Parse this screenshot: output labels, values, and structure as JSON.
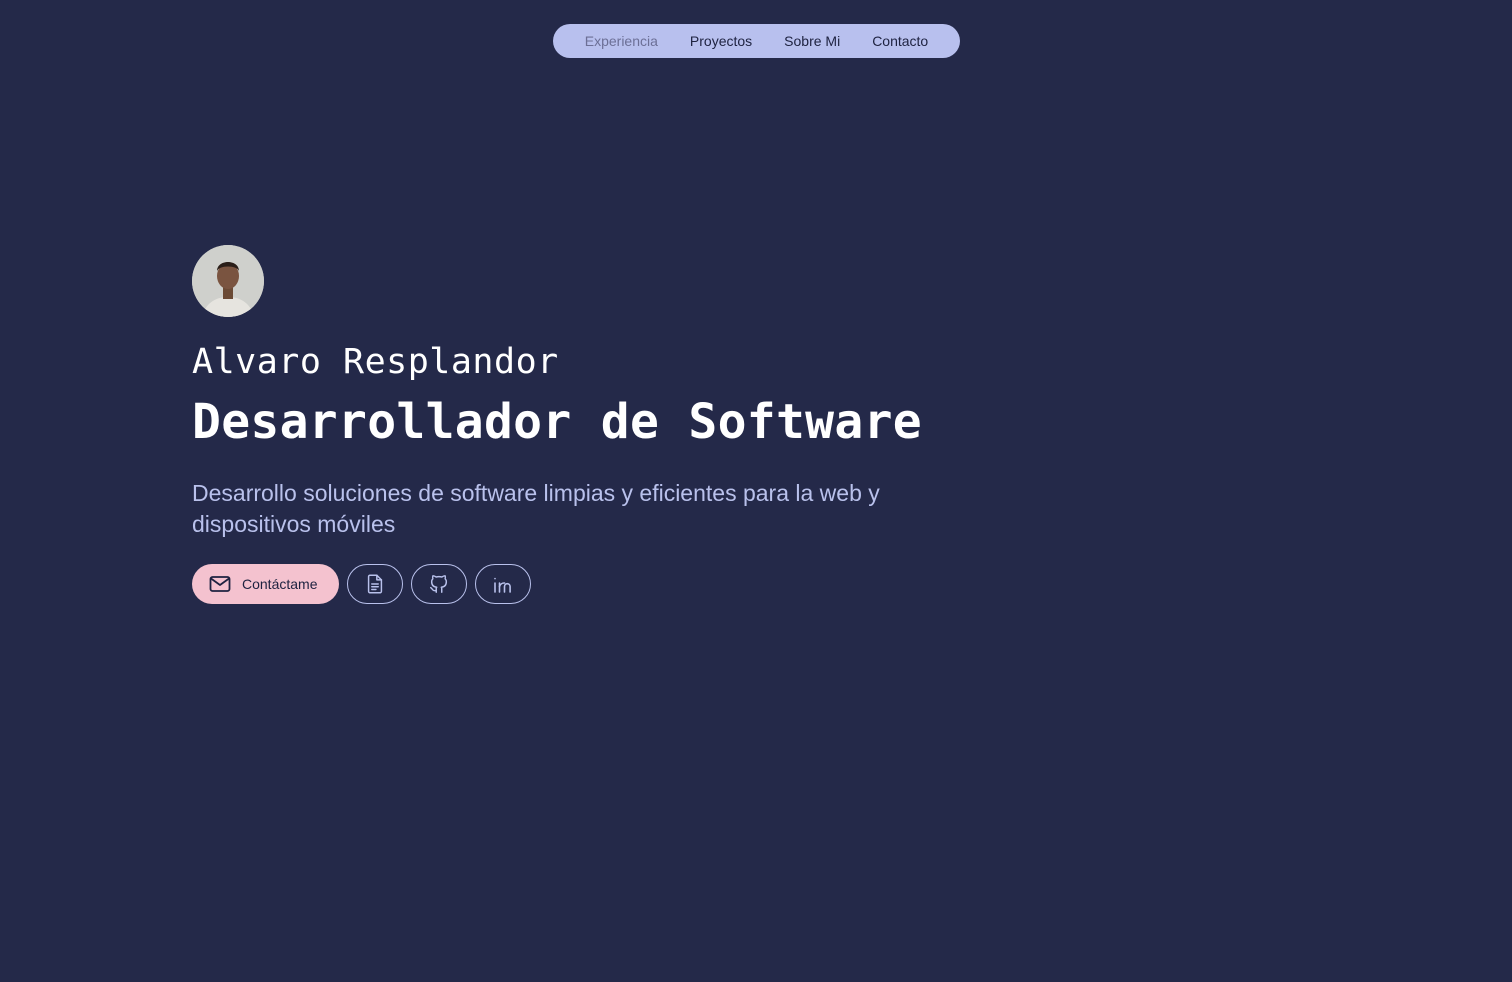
{
  "nav": {
    "items": [
      {
        "label": "Experiencia"
      },
      {
        "label": "Proyectos"
      },
      {
        "label": "Sobre Mi"
      },
      {
        "label": "Contacto"
      }
    ]
  },
  "hero": {
    "avatar_icon": "profile-photo",
    "name": "Alvaro Resplandor",
    "role": "Desarrollador de Software",
    "description": "Desarrollo soluciones de software limpias y eficientes para la web y dispositivos móviles"
  },
  "actions": {
    "contact_label": "Contáctame",
    "contact_icon": "mail-icon",
    "cv_icon": "file-text-icon",
    "github_icon": "github-icon",
    "linkedin_icon": "linkedin-icon"
  },
  "colors": {
    "background": "#242949",
    "nav_pill": "#b8c0ee",
    "contact_button": "#f4c2cf",
    "description_text": "#b9c1ec"
  }
}
